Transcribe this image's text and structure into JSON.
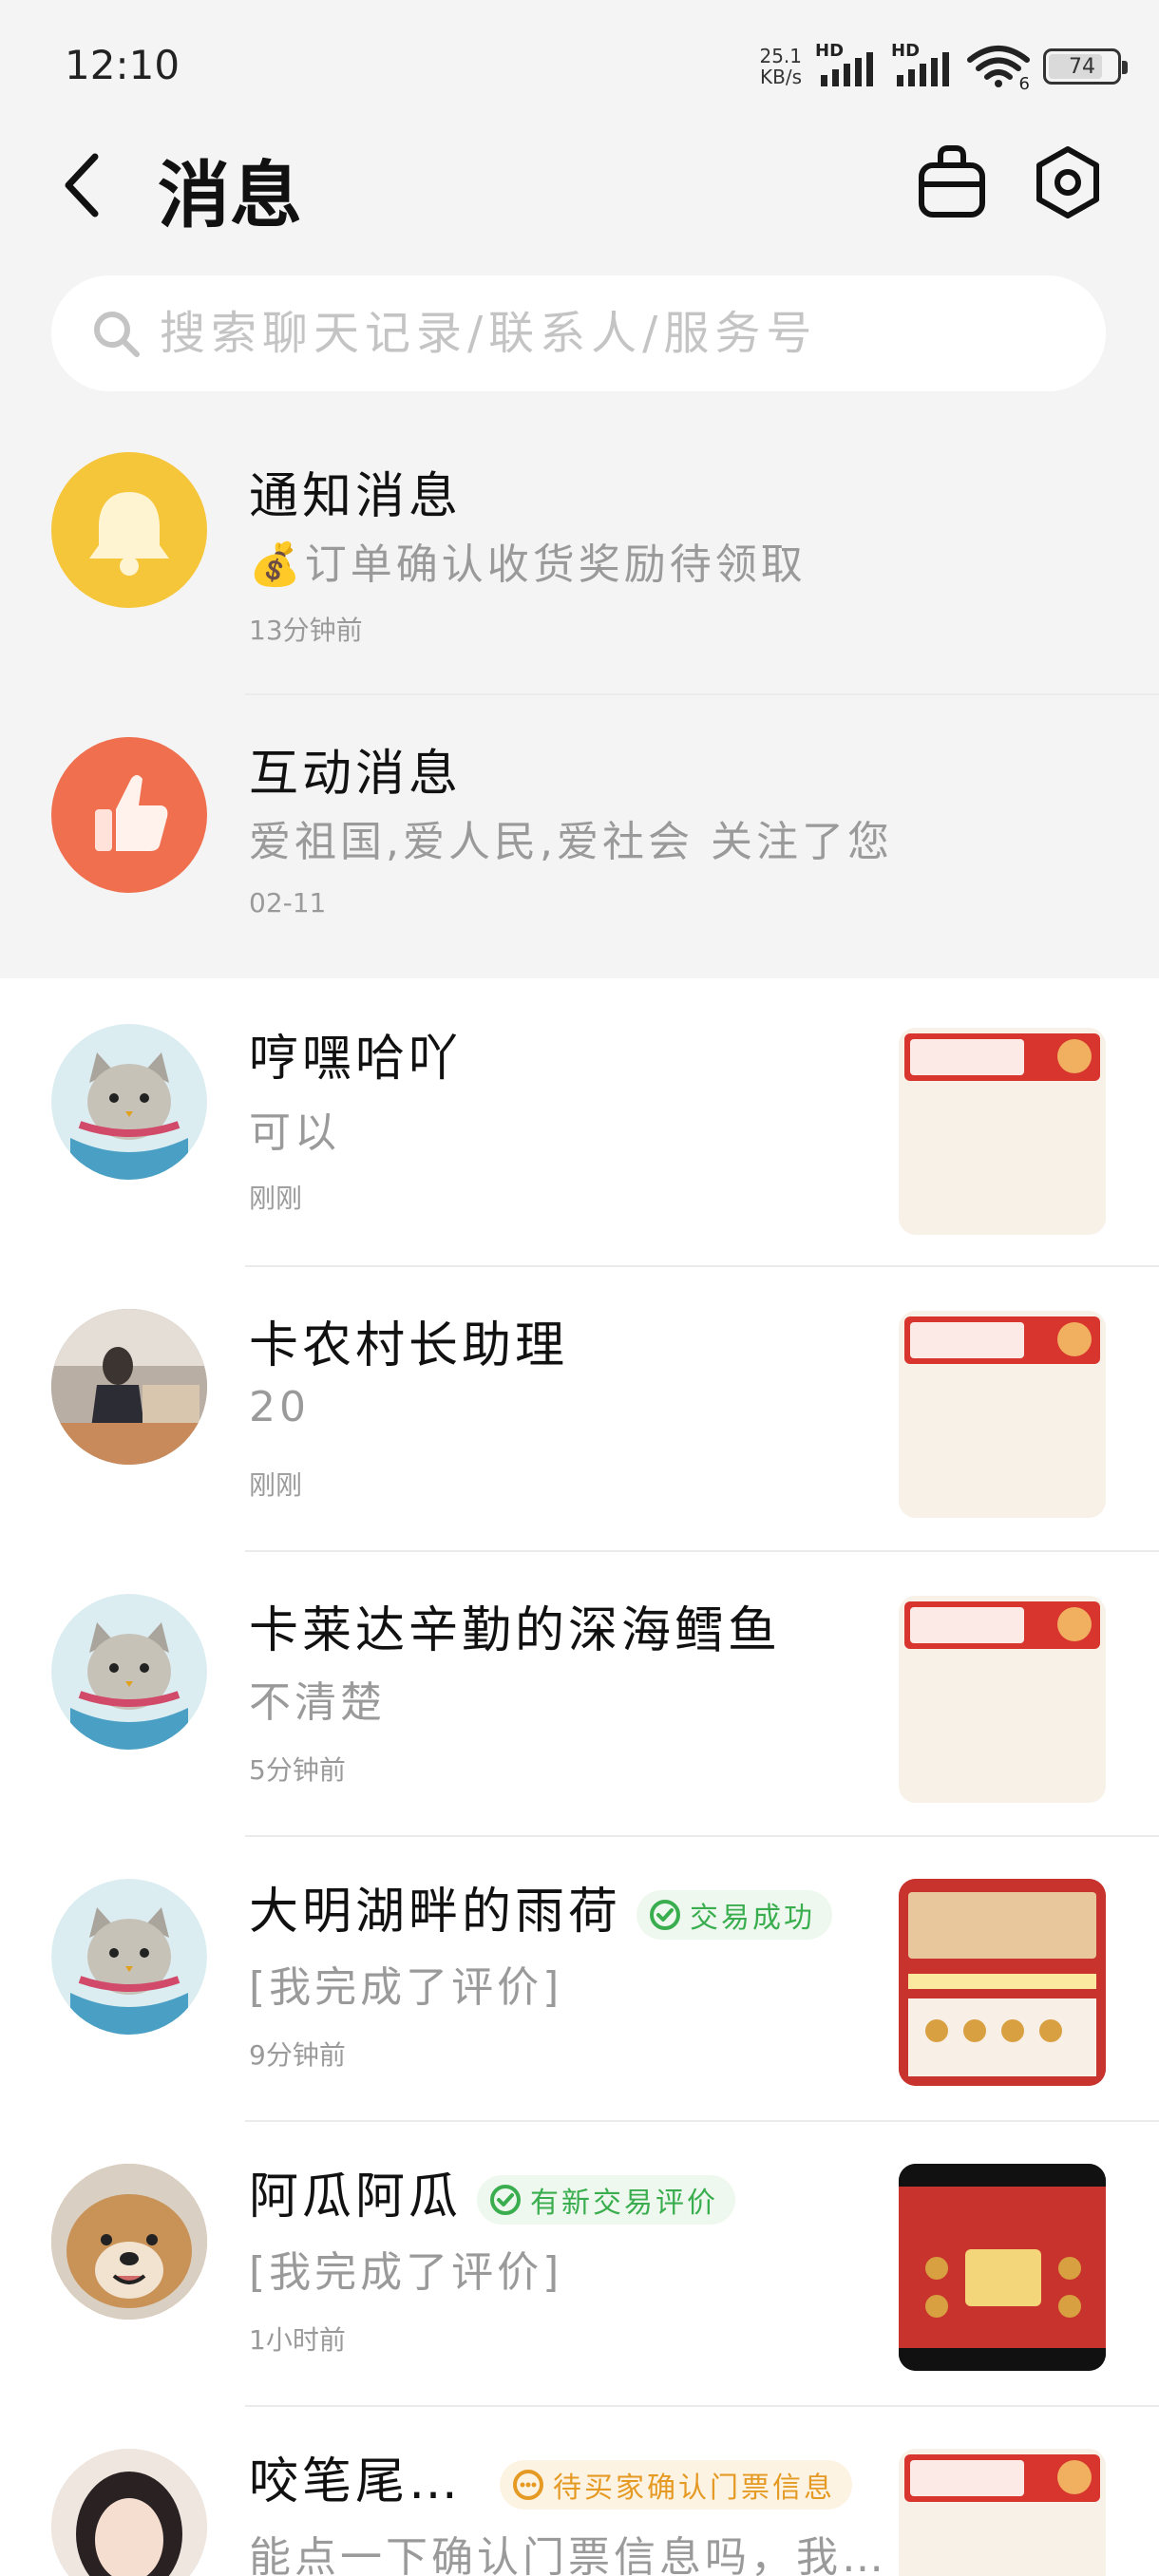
{
  "status_bar": {
    "time": "12:10",
    "net_speed_value": "25.1",
    "net_speed_unit": "KB/s",
    "hd1": "HD",
    "hd2": "HD",
    "wifi_label": "6",
    "battery": "74",
    "battery_level": 0.74
  },
  "header": {
    "title": "消息"
  },
  "search": {
    "placeholder": "搜索聊天记录/联系人/服务号"
  },
  "system_items": [
    {
      "title": "通知消息",
      "subtitle_emoji": "💰",
      "subtitle": "订单确认收货奖励待领取",
      "time": "13分钟前",
      "icon": "bell-icon",
      "color": "#f5c53a"
    },
    {
      "title": "互动消息",
      "subtitle": "爱祖国,爱人民,爱社会 关注了您",
      "time": "02-11",
      "icon": "thumbs-up-icon",
      "color": "#ef6f4f"
    }
  ],
  "chats": [
    {
      "name": "哼嘿哈吖",
      "message": "可以",
      "time": "刚刚",
      "avatar": "cat-avatar"
    },
    {
      "name": "卡农村长助理",
      "message": "20",
      "time": "刚刚",
      "avatar": "photo-avatar"
    },
    {
      "name": "卡莱达辛勤的深海鳕鱼",
      "message": "不清楚",
      "time": "5分钟前",
      "avatar": "cat-avatar"
    },
    {
      "name": "大明湖畔的雨荷",
      "badge": "交易成功",
      "message": "[我完成了评价]",
      "time": "9分钟前",
      "avatar": "cat-avatar"
    },
    {
      "name": "阿瓜阿瓜",
      "badge": "有新交易评价",
      "message": "[我完成了评价]",
      "time": "1小时前",
      "avatar": "dog-avatar"
    },
    {
      "name": "咬笔尾…",
      "badge": "待买家确认门票信息",
      "message": "能点一下确认门票信息吗，我…",
      "time": "",
      "avatar": "girl-avatar"
    }
  ],
  "colors": {
    "green_badge": "#3aae4f",
    "orange_badge": "#e59a24",
    "notify_yellow": "#f5c53a",
    "interact_orange": "#ef6f4f"
  }
}
